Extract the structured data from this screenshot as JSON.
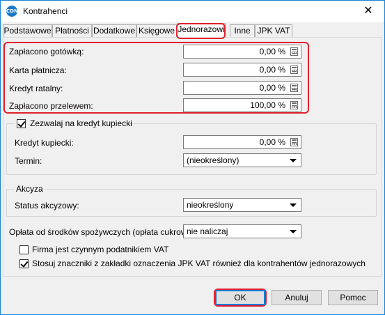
{
  "window": {
    "title": "Kontrahenci",
    "icon": "app-logo-icon",
    "close_glyph": "✕"
  },
  "tabs": [
    {
      "label": "Podstawowe",
      "active": false
    },
    {
      "label": "Płatności",
      "active": false
    },
    {
      "label": "Dodatkowe",
      "active": false
    },
    {
      "label": "Księgowe",
      "active": false
    },
    {
      "label": "Jednorazowi",
      "active": true
    },
    {
      "label": "Inne",
      "active": false
    },
    {
      "label": "JPK VAT",
      "active": false
    }
  ],
  "payments": [
    {
      "label": "Zapłacono gotówką:",
      "value": "0,00 %"
    },
    {
      "label": "Karta płatnicza:",
      "value": "0,00 %"
    },
    {
      "label": "Kredyt ratalny:",
      "value": "0,00 %"
    },
    {
      "label": "Zapłacono przelewem:",
      "value": "100,00 %"
    }
  ],
  "trade_credit": {
    "checkbox_label": "Zezwalaj na kredyt kupiecki",
    "checked": true,
    "credit_label": "Kredyt kupiecki:",
    "credit_value": "0,00 %",
    "term_label": "Termin:",
    "term_value": "(nieokreślony)"
  },
  "excise": {
    "group_title": "Akcyza",
    "status_label": "Status akcyzowy:",
    "status_value": "nieokreślony"
  },
  "sugar_fee": {
    "label": "Opłata od środków spożywczych (opłata cukrowa):",
    "value": "nie naliczaj"
  },
  "options": [
    {
      "label": "Firma jest czynnym podatnikiem VAT",
      "checked": false
    },
    {
      "label": "Stosuj znaczniki z zakładki oznaczenia JPK VAT również dla kontrahentów jednorazowych",
      "checked": true
    }
  ],
  "buttons": {
    "ok": "OK",
    "cancel": "Anuluj",
    "help": "Pomoc"
  },
  "highlight_color": "#e0202e"
}
